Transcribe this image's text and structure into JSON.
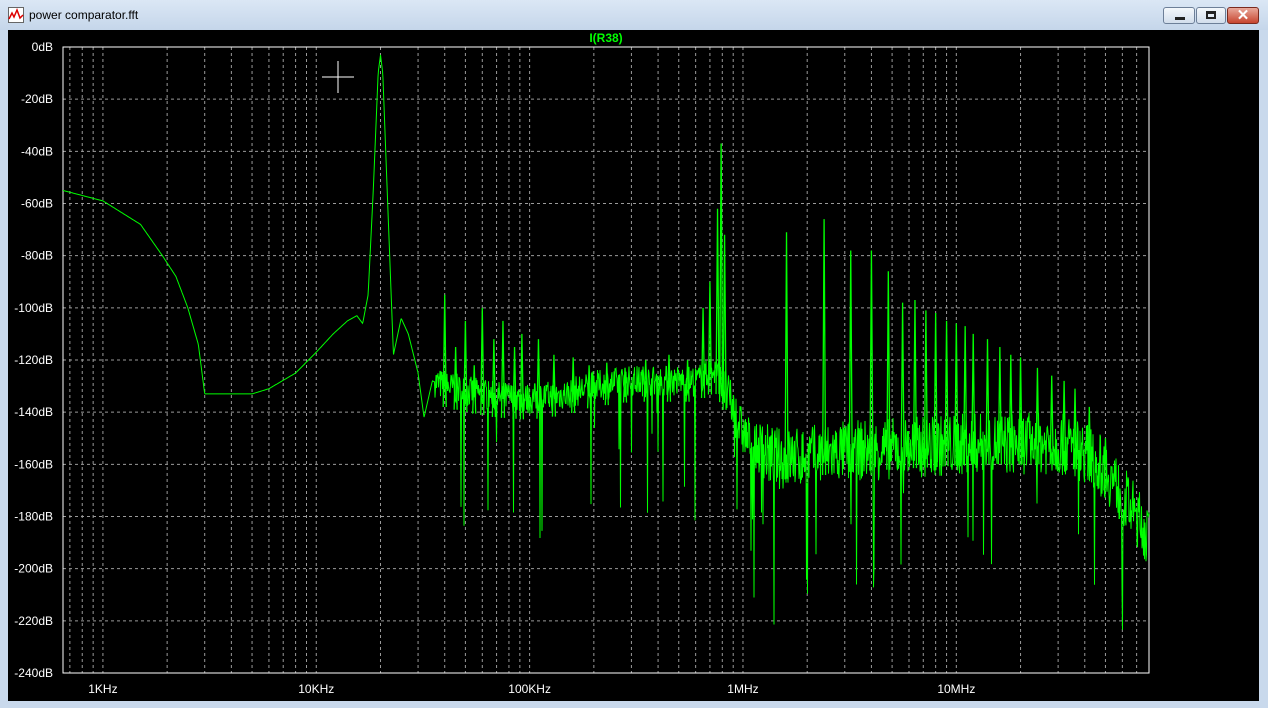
{
  "window": {
    "title": "power comparator.fft",
    "minimize_label": "",
    "maximize_label": "",
    "close_label": "✕",
    "icon": "waveform-icon"
  },
  "plot": {
    "trace_name": "I(R38)",
    "trace_color": "#00ff00",
    "axis_color": "#ffffff",
    "grid_color": "#9a9a9a",
    "cursor": "crosshair-cursor"
  },
  "chart_data": {
    "type": "line",
    "title": "",
    "xlabel": "",
    "ylabel": "",
    "xscale": "log",
    "xlim": [
      650,
      80000000
    ],
    "ylim": [
      -240,
      0
    ],
    "grid": true,
    "legend": "top-center",
    "x_ticks": [
      {
        "value": 1000,
        "label": "1KHz"
      },
      {
        "value": 10000,
        "label": "10KHz"
      },
      {
        "value": 100000,
        "label": "100KHz"
      },
      {
        "value": 1000000,
        "label": "1MHz"
      },
      {
        "value": 10000000,
        "label": "10MHz"
      }
    ],
    "y_ticks": [
      {
        "value": 0,
        "label": "0dB"
      },
      {
        "value": -20,
        "label": "-20dB"
      },
      {
        "value": -40,
        "label": "-40dB"
      },
      {
        "value": -60,
        "label": "-60dB"
      },
      {
        "value": -80,
        "label": "-80dB"
      },
      {
        "value": -100,
        "label": "-100dB"
      },
      {
        "value": -120,
        "label": "-120dB"
      },
      {
        "value": -140,
        "label": "-140dB"
      },
      {
        "value": -160,
        "label": "-160dB"
      },
      {
        "value": -180,
        "label": "-180dB"
      },
      {
        "value": -200,
        "label": "-200dB"
      },
      {
        "value": -220,
        "label": "-220dB"
      },
      {
        "value": -240,
        "label": "-240dB"
      }
    ],
    "series": [
      {
        "name": "I(R38)",
        "baseline": [
          [
            650,
            -55
          ],
          [
            1000,
            -59
          ],
          [
            1500,
            -68
          ],
          [
            1900,
            -80
          ],
          [
            2200,
            -88
          ],
          [
            2500,
            -100
          ],
          [
            2800,
            -114
          ],
          [
            3000,
            -133
          ],
          [
            4000,
            -133
          ],
          [
            5000,
            -133
          ],
          [
            6000,
            -131
          ],
          [
            8000,
            -125
          ],
          [
            10000,
            -117
          ],
          [
            12000,
            -110
          ],
          [
            14000,
            -105
          ],
          [
            15500,
            -103
          ],
          [
            16500,
            -106
          ],
          [
            17500,
            -95
          ],
          [
            18500,
            -55
          ],
          [
            19500,
            -10
          ],
          [
            20000,
            -3
          ],
          [
            20500,
            -10
          ],
          [
            21500,
            -55
          ],
          [
            23000,
            -118
          ],
          [
            25000,
            -104
          ],
          [
            27000,
            -110
          ],
          [
            30000,
            -125
          ],
          [
            32000,
            -142
          ],
          [
            35000,
            -128
          ],
          [
            40000,
            -130
          ],
          [
            50000,
            -132
          ],
          [
            70000,
            -134
          ],
          [
            100000,
            -135
          ],
          [
            150000,
            -133
          ],
          [
            200000,
            -130
          ],
          [
            300000,
            -128
          ],
          [
            400000,
            -128
          ],
          [
            600000,
            -128
          ],
          [
            750000,
            -124
          ],
          [
            850000,
            -134
          ],
          [
            1000000,
            -148
          ],
          [
            1200000,
            -155
          ],
          [
            1500000,
            -158
          ],
          [
            2000000,
            -157
          ],
          [
            3000000,
            -155
          ],
          [
            5000000,
            -154
          ],
          [
            8000000,
            -153
          ],
          [
            12000000,
            -152
          ],
          [
            20000000,
            -152
          ],
          [
            30000000,
            -152
          ],
          [
            40000000,
            -155
          ],
          [
            50000000,
            -162
          ],
          [
            60000000,
            -172
          ],
          [
            70000000,
            -180
          ],
          [
            80000000,
            -188
          ]
        ],
        "peaks": [
          [
            40000,
            -95
          ],
          [
            45000,
            -115
          ],
          [
            50000,
            -105
          ],
          [
            55000,
            -122
          ],
          [
            60000,
            -100
          ],
          [
            68000,
            -112
          ],
          [
            75000,
            -105
          ],
          [
            85000,
            -115
          ],
          [
            92000,
            -110
          ],
          [
            110000,
            -112
          ],
          [
            130000,
            -118
          ],
          [
            160000,
            -119
          ],
          [
            190000,
            -122
          ],
          [
            230000,
            -121
          ],
          [
            280000,
            -123
          ],
          [
            350000,
            -120
          ],
          [
            450000,
            -118
          ],
          [
            550000,
            -120
          ],
          [
            650000,
            -100
          ],
          [
            700000,
            -90
          ],
          [
            760000,
            -62
          ],
          [
            790000,
            -37
          ],
          [
            820000,
            -72
          ],
          [
            1600000,
            -71
          ],
          [
            2400000,
            -66
          ],
          [
            3200000,
            -78
          ],
          [
            4000000,
            -78
          ],
          [
            4800000,
            -86
          ],
          [
            5600000,
            -98
          ],
          [
            6400000,
            -97
          ],
          [
            7200000,
            -101
          ],
          [
            8000000,
            -102
          ],
          [
            9000000,
            -105
          ],
          [
            10000000,
            -106
          ],
          [
            11000000,
            -107
          ],
          [
            12000000,
            -110
          ],
          [
            14000000,
            -112
          ],
          [
            16000000,
            -115
          ],
          [
            18000000,
            -118
          ],
          [
            20000000,
            -119
          ],
          [
            24000000,
            -123
          ],
          [
            28000000,
            -126
          ],
          [
            32000000,
            -128
          ],
          [
            36000000,
            -131
          ],
          [
            42000000,
            -138
          ],
          [
            50000000,
            -150
          ]
        ]
      }
    ]
  }
}
